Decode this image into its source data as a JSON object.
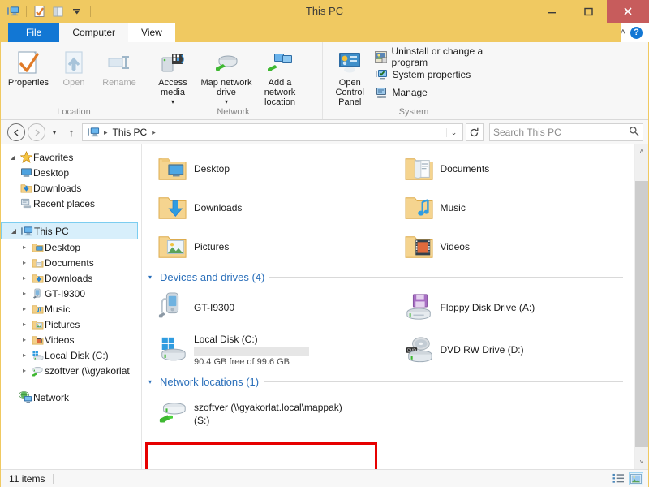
{
  "window": {
    "title": "This PC",
    "accent_color": "#f0c961",
    "close_color": "#c75c5c",
    "minimize_label": "–",
    "maximize_label": "☐",
    "close_label": "✕"
  },
  "quick_access": {
    "items": [
      {
        "name": "this-pc-icon",
        "label": "This PC"
      },
      {
        "name": "properties-icon",
        "label": "Properties"
      },
      {
        "name": "new-folder-icon",
        "label": "New folder"
      },
      {
        "name": "customize-dropdown-icon",
        "label": "Customize Quick Access Toolbar"
      }
    ]
  },
  "tabs": [
    {
      "label": "File",
      "state": "file"
    },
    {
      "label": "Computer",
      "state": "active"
    },
    {
      "label": "View",
      "state": "inactive"
    }
  ],
  "tab_right": {
    "collapse_label": "˄",
    "help_label": "?"
  },
  "ribbon": {
    "groups": [
      {
        "label": "Location",
        "buttons": [
          {
            "label": "Properties",
            "icon": "properties-icon",
            "disabled": false
          },
          {
            "label": "Open",
            "icon": "open-icon",
            "disabled": true
          },
          {
            "label": "Rename",
            "icon": "rename-icon",
            "disabled": true
          }
        ]
      },
      {
        "label": "Network",
        "buttons": [
          {
            "label": "Access media",
            "icon": "access-media-icon",
            "disabled": false,
            "dropdown": true
          },
          {
            "label": "Map network drive",
            "icon": "map-network-drive-icon",
            "disabled": false,
            "dropdown": true
          },
          {
            "label": "Add a network location",
            "icon": "add-network-location-icon",
            "disabled": false,
            "dropdown": false
          }
        ]
      },
      {
        "label": "System",
        "big_button": {
          "label": "Open Control Panel",
          "icon": "control-panel-icon"
        },
        "small_buttons": [
          {
            "label": "Uninstall or change a program",
            "icon": "uninstall-program-icon"
          },
          {
            "label": "System properties",
            "icon": "system-properties-icon"
          },
          {
            "label": "Manage",
            "icon": "manage-icon"
          }
        ]
      }
    ]
  },
  "addressbar": {
    "back_label": "←",
    "forward_label": "→",
    "recent_label": "▾",
    "up_label": "↑",
    "path_icon": "this-pc-icon",
    "crumbs": [
      "This PC"
    ],
    "crumb_separator": "▸",
    "dropdown_label": "⌄",
    "refresh_label": "↻",
    "search_placeholder": "Search This PC",
    "search_value": "",
    "search_icon": "search-icon"
  },
  "sidebar": {
    "groups": [
      {
        "name": "favorites",
        "root": {
          "label": "Favorites",
          "icon": "star-icon",
          "twisty": "open",
          "indent": 1
        },
        "children": [
          {
            "label": "Desktop",
            "icon": "desktop-icon",
            "indent": 2
          },
          {
            "label": "Downloads",
            "icon": "downloads-icon",
            "indent": 2
          },
          {
            "label": "Recent places",
            "icon": "recent-places-icon",
            "indent": 2
          }
        ]
      },
      {
        "name": "this-pc",
        "root": {
          "label": "This PC",
          "icon": "this-pc-icon",
          "twisty": "open",
          "indent": 1,
          "selected": true
        },
        "children": [
          {
            "label": "Desktop",
            "icon": "desktop-folder-icon",
            "indent": 2,
            "twisty": "closed"
          },
          {
            "label": "Documents",
            "icon": "documents-folder-icon",
            "indent": 2,
            "twisty": "closed"
          },
          {
            "label": "Downloads",
            "icon": "downloads-folder-icon",
            "indent": 2,
            "twisty": "closed"
          },
          {
            "label": "GT-I9300",
            "icon": "phone-icon",
            "indent": 2,
            "twisty": "closed"
          },
          {
            "label": "Music",
            "icon": "music-folder-icon",
            "indent": 2,
            "twisty": "closed"
          },
          {
            "label": "Pictures",
            "icon": "pictures-folder-icon",
            "indent": 2,
            "twisty": "closed"
          },
          {
            "label": "Videos",
            "icon": "videos-folder-icon",
            "indent": 2,
            "twisty": "closed"
          },
          {
            "label": "Local Disk (C:)",
            "icon": "local-disk-icon",
            "indent": 2,
            "twisty": "closed"
          },
          {
            "label": "szoftver (\\\\gyakorlat",
            "icon": "network-drive-icon",
            "indent": 2,
            "twisty": "closed"
          }
        ]
      },
      {
        "name": "network",
        "root": {
          "label": "Network",
          "icon": "network-icon",
          "twisty": "none",
          "indent": 1
        },
        "children": []
      }
    ]
  },
  "content": {
    "folders": [
      {
        "label": "Desktop",
        "icon": "desktop-folder-icon"
      },
      {
        "label": "Documents",
        "icon": "documents-folder-icon"
      },
      {
        "label": "Downloads",
        "icon": "downloads-folder-icon"
      },
      {
        "label": "Music",
        "icon": "music-folder-icon"
      },
      {
        "label": "Pictures",
        "icon": "pictures-folder-icon"
      },
      {
        "label": "Videos",
        "icon": "videos-folder-icon"
      }
    ],
    "devices_group": {
      "title": "Devices and drives (4)",
      "twisty": "▾",
      "items": [
        {
          "label": "GT-I9300",
          "icon": "phone-icon",
          "has_bar": false
        },
        {
          "label": "Floppy Disk Drive (A:)",
          "icon": "floppy-drive-icon",
          "has_bar": false
        },
        {
          "label": "Local Disk (C:)",
          "icon": "local-disk-icon",
          "has_bar": true,
          "free_text": "90.4 GB free of 99.6 GB",
          "used_percent": 9,
          "bar_color": "#2196dc"
        },
        {
          "label": "DVD RW Drive (D:)",
          "icon": "dvd-drive-icon",
          "has_bar": false
        }
      ]
    },
    "network_group": {
      "title": "Network locations (1)",
      "twisty": "▾",
      "items": [
        {
          "label_line1": "szoftver (\\\\gyakorlat.local\\mappak)",
          "label_line2": "(S:)",
          "icon": "network-drive-icon",
          "highlighted": true,
          "highlight_color": "#e60000"
        }
      ]
    }
  },
  "scrollbar": {
    "up_label": "˄",
    "down_label": "˅"
  },
  "statusbar": {
    "item_count": "11 items",
    "view_buttons": [
      {
        "name": "details-view-button",
        "active": false
      },
      {
        "name": "large-icons-view-button",
        "active": true
      }
    ]
  }
}
